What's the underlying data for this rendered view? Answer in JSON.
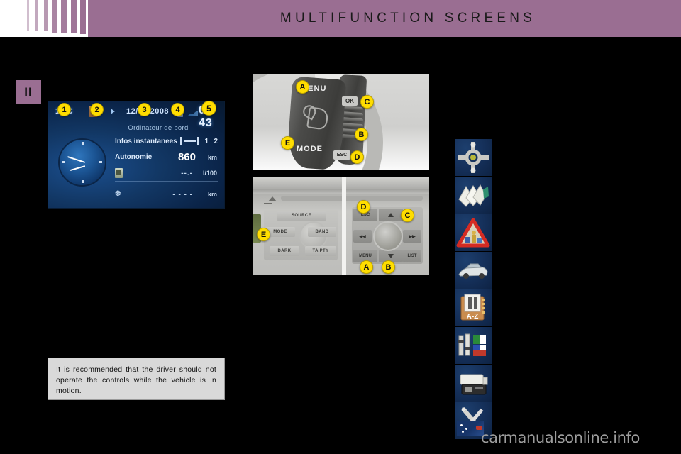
{
  "header": {
    "title": "MULTIFUNCTION SCREENS",
    "bar_color": "#9a6e92"
  },
  "chapter": {
    "label": "II"
  },
  "mfd_display": {
    "temperature": "19°C",
    "date": "12/05/2008",
    "clock_digital": "09 43",
    "subtitle": "Ordinateur de bord",
    "rows": [
      {
        "label": "Infos instantanees",
        "value": "",
        "unit": "",
        "trip1": "1",
        "trip2": "2"
      },
      {
        "label": "Autonomie",
        "value": "860",
        "unit": "km"
      },
      {
        "label": "",
        "value": "--.-",
        "unit": "l/100"
      },
      {
        "label": "",
        "value": "- - - -",
        "unit": "km"
      }
    ],
    "icons": {
      "fuel": "fuel-canister-icon",
      "arrow": "right-arrow-icon",
      "bulb": "bulb-icon",
      "signal": "signal-bars-icon",
      "snow": "snowflake-icon",
      "trip": "trip-meter-icon"
    }
  },
  "photo_stalk": {
    "name": "steering-column-control-photo",
    "labels": {
      "menu": "MENU",
      "mode": "MODE",
      "ok": "OK",
      "esc": "ESC"
    },
    "callouts": [
      "A",
      "B",
      "C",
      "D",
      "E"
    ]
  },
  "photo_radio": {
    "name": "car-radio-panel-photo",
    "left_buttons": [
      "SOURCE",
      "MODE",
      "BAND",
      "DARK",
      "TA PTY"
    ],
    "right_buttons": [
      "ESC",
      "MENU",
      "LIST"
    ],
    "callouts": [
      "A",
      "B",
      "C",
      "D",
      "E"
    ]
  },
  "warning_box": {
    "text": "It is recommended that the driver should not operate the controls while the vehicle is in motion."
  },
  "sidebar": {
    "items": [
      {
        "name": "roundabout-icon",
        "label": "roundabout"
      },
      {
        "name": "manual-pages-icon",
        "label": "pages"
      },
      {
        "name": "warning-triangle-icon",
        "label": "warning"
      },
      {
        "name": "vehicle-icon",
        "label": "vehicle"
      },
      {
        "name": "a-z-index-icon",
        "label": "A-Z"
      },
      {
        "name": "equipment-flags-icon",
        "label": "equipment"
      },
      {
        "name": "printer-icon",
        "label": "printer"
      },
      {
        "name": "tools-icon",
        "label": "tools"
      }
    ]
  },
  "watermark": {
    "text": "carmanualsonline.info"
  }
}
